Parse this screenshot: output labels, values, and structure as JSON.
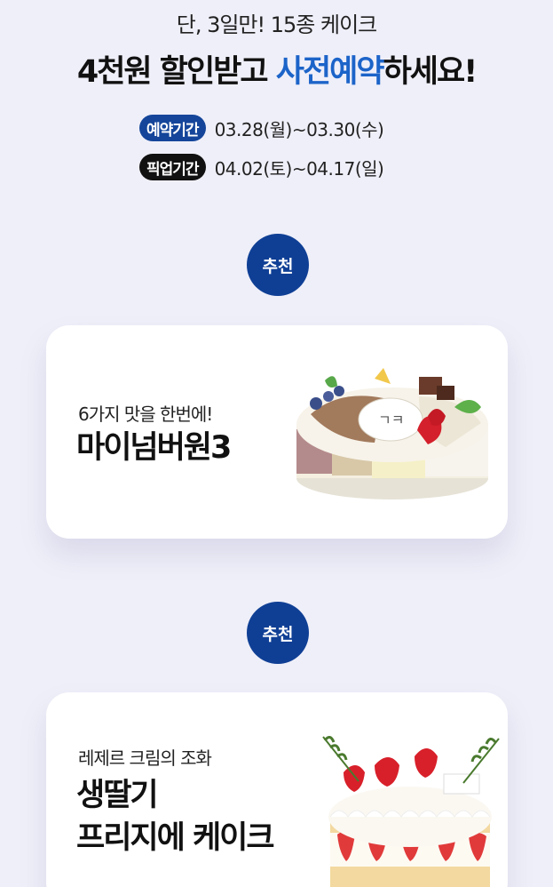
{
  "header": {
    "subtitle": "단, 3일만! 15종 케이크",
    "headline_part1": "4천원 할인받고 ",
    "headline_accent": "사전예약",
    "headline_part2": "하세요!"
  },
  "periods": [
    {
      "label": "예약기간",
      "value": "03.28(월)~03.30(수)"
    },
    {
      "label": "픽업기간",
      "value": "04.02(토)~04.17(일)"
    }
  ],
  "products": [
    {
      "badge": "추천",
      "tagline": "6가지 맛을 한번에!",
      "title_lines": [
        "마이넘버원3"
      ]
    },
    {
      "badge": "추천",
      "tagline": "레제르 크림의 조화",
      "title_lines": [
        "생딸기",
        "프리지에 케이크"
      ]
    }
  ],
  "colors": {
    "accent": "#1c64c9",
    "badge": "#0f3f95",
    "background": "#efeff9"
  }
}
